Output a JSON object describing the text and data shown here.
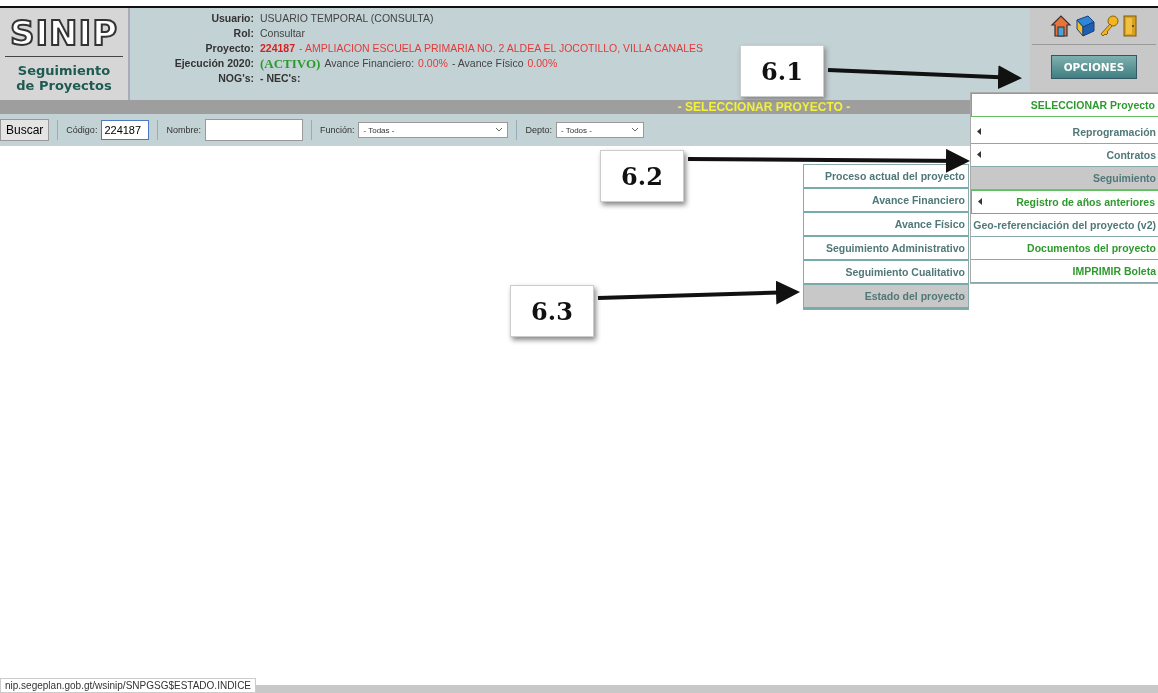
{
  "header": {
    "logo": "SINIP",
    "subtitle_lines": [
      "Seguimiento",
      "de Proyectos"
    ],
    "fields": [
      {
        "label": "Usuario:",
        "parts": [
          {
            "text": "USUARIO TEMPORAL (CONSULTA)",
            "kind": "plain"
          }
        ]
      },
      {
        "label": "Rol:",
        "parts": [
          {
            "text": "Consultar",
            "kind": "plain"
          }
        ]
      },
      {
        "label": "Proyecto:",
        "parts": [
          {
            "text": "224187",
            "kind": "red-bold"
          },
          {
            "text": "- AMPLIACION ESCUELA PRIMARIA NO. 2 ALDEA EL JOCOTILLO, VILLA CANALES",
            "kind": "red"
          }
        ]
      },
      {
        "label": "Ejecución 2020:",
        "parts": [
          {
            "text": "(ACTIVO)",
            "kind": "status"
          },
          {
            "text": "Avance Financiero:",
            "kind": "plain"
          },
          {
            "text": "0.00%",
            "kind": "red"
          },
          {
            "text": "- Avance Físico",
            "kind": "plain"
          },
          {
            "text": "0.00%",
            "kind": "red"
          }
        ]
      },
      {
        "label": "NOG's:",
        "parts": [
          {
            "text": "- NEC's:",
            "kind": "bold"
          }
        ]
      }
    ],
    "options_button": "OPCIONES"
  },
  "band_title": "- SELECCIONAR PROYECTO -",
  "search": {
    "button": "Buscar",
    "code_label": "Código:",
    "code_value": "224187",
    "name_label": "Nombre:",
    "function_label": "Función:",
    "function_value": "- Todas -",
    "dept_label": "Depto:",
    "dept_value": "- Todos -"
  },
  "options_menu": [
    {
      "label": "SELECCIONAR Proyecto",
      "kind": "primary",
      "submenu": false,
      "highlighted": false
    },
    {
      "label": "Reprogramación",
      "kind": "normal",
      "submenu": true,
      "highlighted": false
    },
    {
      "label": "Contratos",
      "kind": "normal",
      "submenu": true,
      "highlighted": false
    },
    {
      "label": "Seguimiento",
      "kind": "normal",
      "submenu": false,
      "highlighted": true
    },
    {
      "label": "Registro de años anteriores",
      "kind": "primary",
      "submenu": true,
      "highlighted": false
    },
    {
      "label": "Geo-referenciación del proyecto (v2)",
      "kind": "normal",
      "submenu": false,
      "highlighted": false
    },
    {
      "label": "Documentos del proyecto",
      "kind": "primary",
      "submenu": false,
      "highlighted": false
    },
    {
      "label": "IMPRIMIR Boleta",
      "kind": "primary",
      "submenu": false,
      "highlighted": false
    }
  ],
  "submenu": [
    {
      "label": "Proceso actual del proyecto",
      "highlighted": false
    },
    {
      "label": "Avance Financiero",
      "highlighted": false
    },
    {
      "label": "Avance Físico",
      "highlighted": false
    },
    {
      "label": "Seguimiento Administrativo",
      "highlighted": false
    },
    {
      "label": "Seguimiento Cualitativo",
      "highlighted": false
    },
    {
      "label": "Estado del proyecto",
      "highlighted": true
    }
  ],
  "callouts": [
    "6.1",
    "6.2",
    "6.3"
  ],
  "status_url": "nip.segeplan.gob.gt/wsinip/SNPGSG$ESTADO.INDICE"
}
